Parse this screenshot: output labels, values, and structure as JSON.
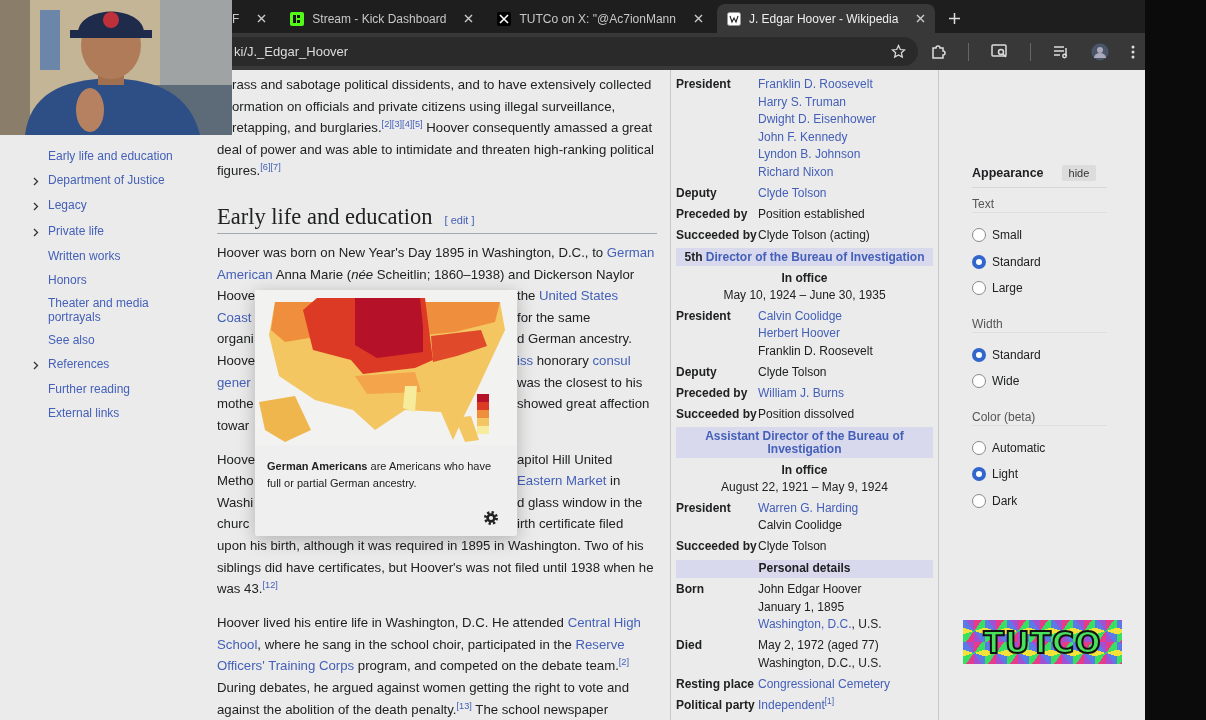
{
  "browser": {
    "tabs": [
      {
        "title": "F",
        "selected": false,
        "kind": "plain"
      },
      {
        "title": "Stream - Kick Dashboard",
        "selected": false,
        "kind": "kick"
      },
      {
        "title": "TUTCo on X: \"@Ac7ionMann",
        "selected": false,
        "kind": "x"
      },
      {
        "title": "J. Edgar Hoover - Wikipedia",
        "selected": true,
        "kind": "wiki"
      }
    ],
    "address": "ki/J._Edgar_Hoover"
  },
  "toc": [
    {
      "label": "Early life and education",
      "expandable": false
    },
    {
      "label": "Department of Justice",
      "expandable": true
    },
    {
      "label": "Legacy",
      "expandable": true
    },
    {
      "label": "Private life",
      "expandable": true
    },
    {
      "label": "Written works",
      "expandable": false
    },
    {
      "label": "Honors",
      "expandable": false
    },
    {
      "label": "Theater and media portrayals",
      "expandable": false
    },
    {
      "label": "See also",
      "expandable": false
    },
    {
      "label": "References",
      "expandable": true
    },
    {
      "label": "Further reading",
      "expandable": false
    },
    {
      "label": "External links",
      "expandable": false
    }
  ],
  "article": [
    {
      "kind": "paragraph",
      "lines": [
        {
          "kind": "clipped",
          "segs": [
            {
              "t": "rass and sabotage political dissidents, and to have extensively collected"
            }
          ]
        },
        {
          "kind": "clipped",
          "segs": [
            {
              "t": "ormation on officials and private citizens using illegal surveillance,"
            }
          ]
        },
        {
          "kind": "clipped",
          "segs": [
            {
              "t": "retapping, and burglaries."
            },
            {
              "t": "$^{[2][3][4][5]}$",
              "link": true
            },
            {
              "t": " Hoover consequently amassed a great"
            }
          ]
        },
        {
          "kind": "full",
          "segs": [
            {
              "t": "deal of power and was able to intimidate and threaten high-ranking political"
            }
          ]
        },
        {
          "kind": "full",
          "segs": [
            {
              "t": "figures."
            },
            {
              "t": "$^{[6][7]}$",
              "link": true
            }
          ]
        }
      ]
    },
    {
      "kind": "heading",
      "title": "Early life and education",
      "edit": "[ edit ]"
    },
    {
      "kind": "paragraph",
      "lines": [
        {
          "kind": "full",
          "segs": [
            {
              "t": "Hoover was born on New Year's Day 1895 in Washington, D.C., to "
            },
            {
              "t": "German",
              "link": true
            }
          ]
        },
        {
          "kind": "full",
          "segs": [
            {
              "t": "American",
              "link": true
            },
            {
              "t": " Anna Marie (*née* Scheitlin; 1860–1938) and Dickerson Naylor"
            }
          ]
        },
        {
          "kind": "split",
          "left": [
            {
              "t": "Hoove"
            }
          ],
          "right": [
            {
              "t": "the "
            },
            {
              "t": "United States",
              "link": true
            }
          ]
        },
        {
          "kind": "split",
          "left": [
            {
              "t": "Coast",
              "link": true
            }
          ],
          "right": [
            {
              "t": "for the same"
            }
          ]
        },
        {
          "kind": "split",
          "left": [
            {
              "t": "organi"
            }
          ],
          "right": [
            {
              "t": "d German ancestry."
            }
          ]
        },
        {
          "kind": "split",
          "left": [
            {
              "t": "Hoove"
            }
          ],
          "right": [
            {
              "t": "iss",
              "link": true
            },
            {
              "t": " honorary "
            },
            {
              "t": "consul",
              "link": true
            }
          ]
        },
        {
          "kind": "split",
          "left": [
            {
              "t": "gener",
              "link": true
            }
          ],
          "right": [
            {
              "t": "was the closest to his"
            }
          ]
        },
        {
          "kind": "split",
          "left": [
            {
              "t": "mothe"
            }
          ],
          "right": [
            {
              "t": "showed great affection"
            }
          ]
        },
        {
          "kind": "split",
          "left": [
            {
              "t": "towar"
            }
          ]
        }
      ]
    },
    {
      "kind": "paragraph",
      "lines": [
        {
          "kind": "split",
          "left": [
            {
              "t": "Hoove"
            }
          ],
          "right": [
            {
              "t": "apitol Hill United"
            }
          ]
        },
        {
          "kind": "split",
          "left": [
            {
              "t": "Metho"
            }
          ],
          "right": [
            {
              "t": "Eastern Market",
              "link": true
            },
            {
              "t": " in"
            }
          ]
        },
        {
          "kind": "split",
          "left": [
            {
              "t": "Washi"
            }
          ],
          "right": [
            {
              "t": "d glass window in the"
            }
          ]
        },
        {
          "kind": "split",
          "left": [
            {
              "t": "churc"
            }
          ],
          "right": [
            {
              "t": "irth certificate filed"
            }
          ]
        },
        {
          "kind": "full",
          "segs": [
            {
              "t": "upon his birth, although it was required in 1895 in Washington. Two of his"
            }
          ]
        },
        {
          "kind": "full",
          "segs": [
            {
              "t": "siblings did have certificates, but Hoover's was not filed until 1938 when he"
            }
          ]
        },
        {
          "kind": "full",
          "segs": [
            {
              "t": "was 43."
            },
            {
              "t": "$^{[12]}$",
              "link": true
            }
          ]
        }
      ]
    },
    {
      "kind": "paragraph",
      "lines": [
        {
          "kind": "full",
          "segs": [
            {
              "t": "Hoover lived his entire life in Washington, D.C. He attended "
            },
            {
              "t": "Central High",
              "link": true
            }
          ]
        },
        {
          "kind": "full",
          "segs": [
            {
              "t": "School",
              "link": true
            },
            {
              "t": ", where he sang in the school choir, participated in the "
            },
            {
              "t": "Reserve",
              "link": true
            }
          ]
        },
        {
          "kind": "full",
          "segs": [
            {
              "t": "Officers' Training Corps",
              "link": true
            },
            {
              "t": " program, and competed on the debate team."
            },
            {
              "t": "$^{[2]}$",
              "link": true
            }
          ]
        },
        {
          "kind": "full",
          "segs": [
            {
              "t": "During debates, he argued against women getting the right to vote and"
            }
          ]
        },
        {
          "kind": "full",
          "segs": [
            {
              "t": "against the abolition of the death penalty."
            },
            {
              "t": "$^{[13]}$",
              "link": true
            },
            {
              "t": " The school newspaper"
            }
          ]
        }
      ]
    }
  ],
  "popup": {
    "summary": "**German Americans** are Americans who have full or partial German ancestry."
  },
  "infobox": [
    {
      "kind": "field",
      "label": "President",
      "lines": [
        [
          {
            "t": "Franklin D. Roosevelt",
            "link": true
          }
        ],
        [
          {
            "t": "Harry S. Truman",
            "link": true
          }
        ],
        [
          {
            "t": "Dwight D. Eisenhower",
            "link": true
          }
        ],
        [
          {
            "t": "John F. Kennedy",
            "link": true
          }
        ],
        [
          {
            "t": "Lyndon B. Johnson",
            "link": true
          }
        ],
        [
          {
            "t": "Richard Nixon",
            "link": true
          }
        ]
      ]
    },
    {
      "kind": "field",
      "label": "Deputy",
      "lines": [
        [
          {
            "t": "Clyde Tolson",
            "link": true
          }
        ]
      ]
    },
    {
      "kind": "field",
      "label": "Preceded by",
      "lines": [
        [
          {
            "t": "Position established"
          }
        ]
      ]
    },
    {
      "kind": "field",
      "label": "Succeeded by",
      "lines": [
        [
          {
            "t": "Clyde Tolson (acting)"
          }
        ]
      ]
    },
    {
      "kind": "header",
      "segs": [
        {
          "t": "5th "
        },
        {
          "t": "Director of the Bureau of Investigation",
          "link": true
        }
      ]
    },
    {
      "kind": "office",
      "label": "In office",
      "dates": "May 10, 1924 – June 30, 1935"
    },
    {
      "kind": "field",
      "label": "President",
      "lines": [
        [
          {
            "t": "Calvin Coolidge",
            "link": true
          }
        ],
        [
          {
            "t": "Herbert Hoover",
            "link": true
          }
        ],
        [
          {
            "t": "Franklin D. Roosevelt"
          }
        ]
      ]
    },
    {
      "kind": "field",
      "label": "Deputy",
      "lines": [
        [
          {
            "t": "Clyde Tolson"
          }
        ]
      ]
    },
    {
      "kind": "field",
      "label": "Preceded by",
      "lines": [
        [
          {
            "t": "William J. Burns",
            "link": true
          }
        ]
      ]
    },
    {
      "kind": "field",
      "label": "Succeeded by",
      "lines": [
        [
          {
            "t": "Position dissolved"
          }
        ]
      ]
    },
    {
      "kind": "header",
      "segs": [
        {
          "t": "Assistant Director of the Bureau of Investigation",
          "link": true
        }
      ]
    },
    {
      "kind": "office",
      "label": "In office",
      "dates": "August 22, 1921 – May 9, 1924"
    },
    {
      "kind": "field",
      "label": "President",
      "lines": [
        [
          {
            "t": "Warren G. Harding",
            "link": true
          }
        ],
        [
          {
            "t": "Calvin Coolidge"
          }
        ]
      ]
    },
    {
      "kind": "field",
      "label": "Succeeded by",
      "lines": [
        [
          {
            "t": "Clyde Tolson"
          }
        ]
      ]
    },
    {
      "kind": "header",
      "segs": [
        {
          "t": "Personal details"
        }
      ]
    },
    {
      "kind": "field",
      "label": "Born",
      "lines": [
        [
          {
            "t": "John Edgar Hoover"
          }
        ],
        [
          {
            "t": "January 1, 1895"
          }
        ],
        [
          {
            "t": "Washington, D.C.",
            "link": true
          },
          {
            "t": ", U.S."
          }
        ]
      ]
    },
    {
      "kind": "field",
      "label": "Died",
      "lines": [
        [
          {
            "t": "May 2, 1972 (aged 77)"
          }
        ],
        [
          {
            "t": "Washington, D.C., U.S."
          }
        ]
      ]
    },
    {
      "kind": "field",
      "label": "Resting place",
      "lines": [
        [
          {
            "t": "Congressional Cemetery",
            "link": true
          }
        ]
      ]
    },
    {
      "kind": "field",
      "label": "Political party",
      "lines": [
        [
          {
            "t": "Independent",
            "link": true
          },
          {
            "t": "$^{[1]}$",
            "link": true
          }
        ]
      ]
    }
  ],
  "appearance": {
    "title": "Appearance",
    "hide": "hide",
    "groups": [
      {
        "label": "Text",
        "options": [
          {
            "label": "Small",
            "selected": false
          },
          {
            "label": "Standard",
            "selected": true
          },
          {
            "label": "Large",
            "selected": false
          }
        ]
      },
      {
        "label": "Width",
        "options": [
          {
            "label": "Standard",
            "selected": true
          },
          {
            "label": "Wide",
            "selected": false
          }
        ]
      },
      {
        "label": "Color (beta)",
        "options": [
          {
            "label": "Automatic",
            "selected": false
          },
          {
            "label": "Light",
            "selected": true
          },
          {
            "label": "Dark",
            "selected": false
          }
        ]
      }
    ]
  },
  "stream_logo": {
    "text": "TUTCO"
  }
}
